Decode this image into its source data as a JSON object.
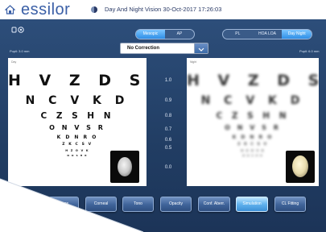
{
  "header": {
    "brand": "essilor",
    "title": "Day And Night Vision   30-Oct-2017   17:26:03",
    "home_icon": "home-icon",
    "mode_icon": "sun-moon-icon"
  },
  "controls": {
    "vision_toggle": [
      "Mesopic",
      "AP"
    ],
    "vision_active": 0,
    "display_toggle": [
      "PL",
      "HOA LOA",
      "Day Night"
    ],
    "display_active": 2,
    "correction": "No Correction",
    "pupil_left": "Pupil: 3.0 mm",
    "pupil_right": "Pupil: 6.0 mm"
  },
  "chart": {
    "rows": [
      "H V Z D S",
      "N C V K D",
      "C Z S H N",
      "O N V S R",
      "K D N R O",
      "Z K C S V",
      "H Z O V K",
      "N D S H R"
    ],
    "acuity": [
      "1.0",
      "0.9",
      "0.8",
      "0.7",
      "0.6",
      "0.5",
      "0.0"
    ],
    "tag_left": "Day",
    "tag_right": "Night"
  },
  "toolbar": {
    "buttons": [
      "Zernike",
      "Maps",
      "Corneal",
      "Tono",
      "Opacity",
      "Conf. Aberr.",
      "Simulation",
      "CL Fitting"
    ],
    "active": 6
  },
  "colors": {
    "panel": "#213d63",
    "accent": "#3c8fd6",
    "brand": "#3a5fa6"
  }
}
